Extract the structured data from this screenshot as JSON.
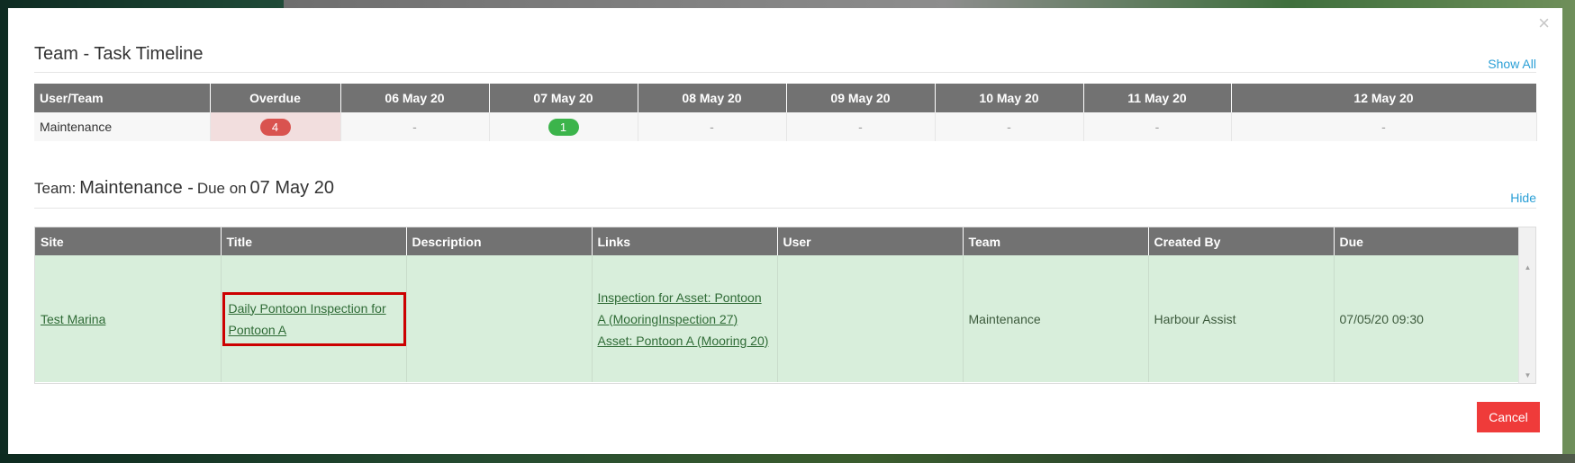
{
  "modal": {
    "close_glyph": "×",
    "timeline_title": "Team - Task Timeline",
    "show_all_label": "Show All",
    "cancel_label": "Cancel"
  },
  "timeline": {
    "headers": [
      "User/Team",
      "Overdue",
      "06 May 20",
      "07 May 20",
      "08 May 20",
      "09 May 20",
      "10 May 20",
      "11 May 20",
      "12 May 20"
    ],
    "row": {
      "team": "Maintenance",
      "overdue_count": "4",
      "cells": [
        "-",
        "1",
        "-",
        "-",
        "-",
        "-",
        "-"
      ]
    }
  },
  "detail": {
    "prefix": "Team:",
    "team": "Maintenance -",
    "due_label": "Due on",
    "due_date": "07 May 20",
    "hide_label": "Hide"
  },
  "tasks": {
    "headers": [
      "Site",
      "Title",
      "Description",
      "Links",
      "User",
      "Team",
      "Created By",
      "Due"
    ],
    "rows": [
      {
        "site": "Test Marina",
        "title": "Daily Pontoon Inspection for Pontoon A",
        "description": "",
        "link1": "Inspection for Asset: Pontoon A (MooringInspection 27)",
        "link2": "Asset: Pontoon A (Mooring 20)",
        "user": "",
        "team": "Maintenance",
        "created_by": "Harbour Assist",
        "due": "07/05/20 09:30"
      }
    ]
  },
  "colors": {
    "header_bg": "#727272",
    "overdue_badge": "#d9534f",
    "due_badge": "#3cb44b",
    "row_highlight": "#d8eedb",
    "link": "#2a9fd6",
    "cancel": "#ef3b3a",
    "focus_box": "#cc0000"
  }
}
